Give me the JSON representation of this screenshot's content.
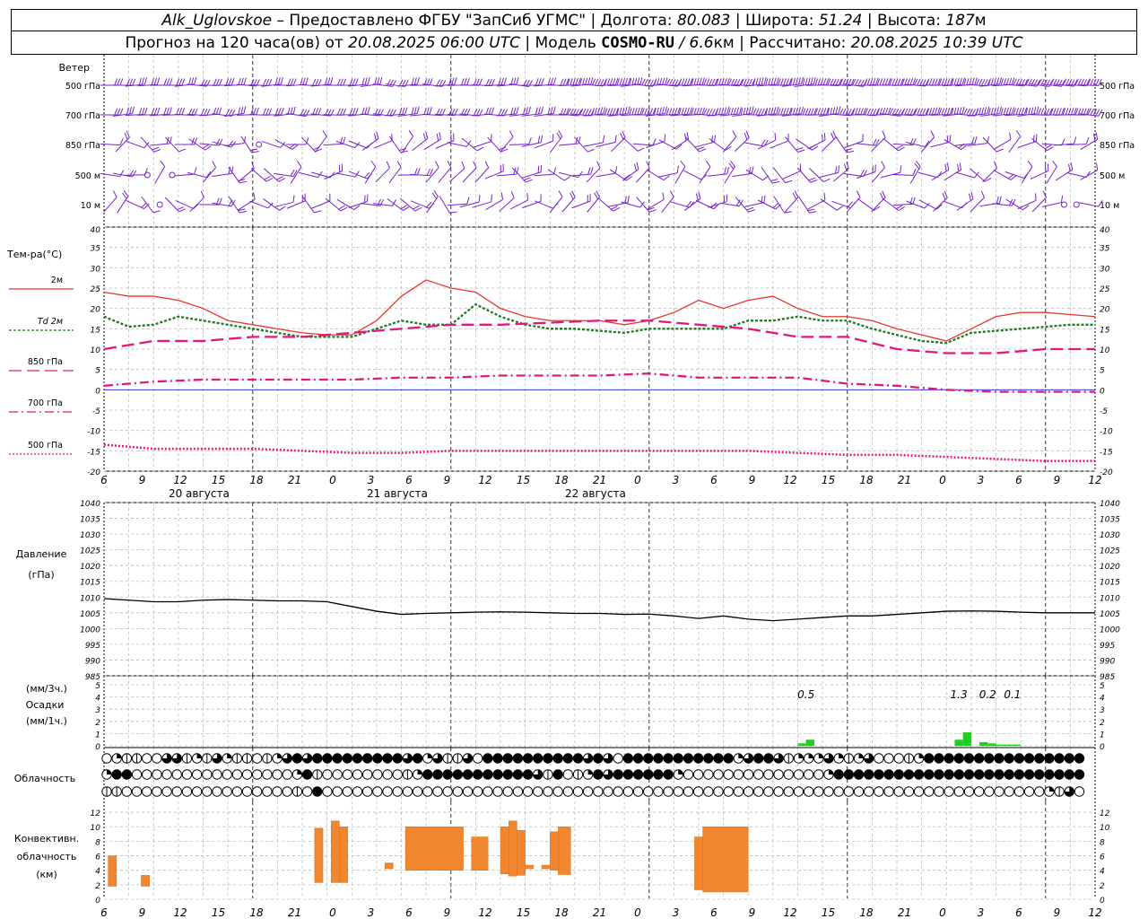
{
  "header": {
    "station": "Alk_Uglovskoe",
    "provider_text": " – Предоставлено ФГБУ \"ЗапСиб УГМС\" | Долгота: ",
    "longitude": "80.083",
    "lat_label": " | Широта: ",
    "latitude": "51.24",
    "alt_label": " | Высота: ",
    "altitude": "187",
    "alt_unit": "м",
    "forecast_label": "Прогноз на 120 часа(ов) от ",
    "forecast_from": "20.08.2025 06:00 UTC",
    "model_label": "  | Модель ",
    "model_name": "COSMO-RU",
    "resolution": " / 6.6",
    "resolution_unit": "км",
    "calc_label": " | Рассчитано: ",
    "calc_time": "20.08.2025 10:39 UTC"
  },
  "labels": {
    "wind": "Ветер",
    "wind_levels": [
      "500 гПа",
      "700 гПа",
      "850 гПа",
      "500 м",
      "10  м"
    ],
    "temp": "Тем-ра(°C)",
    "temp_legend": [
      "2м",
      "Td  2м",
      "850 гПа",
      "700 гПа",
      "500 гПа"
    ],
    "pressure": [
      "Давление",
      "(гПа)"
    ],
    "precip": [
      "(мм/3ч.)",
      "Осадки",
      "(мм/1ч.)"
    ],
    "cloud": "Облачность",
    "conv": [
      "Конвективн.",
      "облачность",
      "(км)"
    ],
    "dates": [
      "20 августа",
      "21 августа",
      "22 августа"
    ]
  },
  "colors": {
    "t2m": "#e8372c",
    "td2m": "#1e7a1e",
    "t850": "#e0197d",
    "t700": "#e0197d",
    "t500": "#e0197d",
    "pressure": "#000000",
    "precip": "#22cc22",
    "conv": "#f0862e",
    "wind": "#7722cc",
    "zero_line": "#2222cc"
  },
  "chart_data": [
    {
      "type": "line",
      "title": "Тем-ра(°C)",
      "x_unit": "hours since 20.08 06 UTC",
      "x_ticks": [
        "6",
        "9",
        "12",
        "15",
        "18",
        "21",
        "0",
        "3",
        "6",
        "9",
        "12",
        "15",
        "18",
        "21",
        "0",
        "3",
        "6",
        "9",
        "12",
        "15",
        "18",
        "21",
        "0",
        "3",
        "6",
        "9",
        "12"
      ],
      "ylim": [
        -20,
        40
      ],
      "y_ticks": [
        -20,
        -15,
        -10,
        -5,
        0,
        5,
        10,
        15,
        20,
        25,
        30,
        35,
        40
      ],
      "series": [
        {
          "name": "2м",
          "x": [
            0,
            3,
            6,
            9,
            12,
            15,
            18,
            21,
            24,
            27,
            30,
            33,
            36,
            39,
            42,
            45,
            48,
            51,
            54,
            57,
            60,
            63,
            66,
            69,
            72,
            75,
            78,
            81,
            84,
            87,
            90,
            93,
            96,
            99,
            102,
            105,
            108,
            111,
            114,
            117,
            120
          ],
          "y": [
            24,
            23,
            23,
            22,
            20,
            17,
            16,
            15,
            14,
            13.5,
            13.5,
            17,
            23,
            27,
            25,
            24,
            20,
            18,
            17,
            17,
            17,
            16,
            17,
            19,
            22,
            20,
            22,
            23,
            20,
            18,
            18,
            17,
            15,
            13.5,
            12,
            15,
            18,
            19,
            19,
            18.5,
            18
          ]
        },
        {
          "name": "Td  2м",
          "x": [
            0,
            3,
            6,
            9,
            12,
            15,
            18,
            21,
            24,
            27,
            30,
            33,
            36,
            39,
            42,
            45,
            48,
            51,
            54,
            57,
            60,
            63,
            66,
            69,
            72,
            75,
            78,
            81,
            84,
            87,
            90,
            93,
            96,
            99,
            102,
            105,
            108,
            111,
            114,
            117,
            120
          ],
          "y": [
            18,
            15.5,
            16,
            18,
            17,
            16,
            15,
            14,
            13,
            13,
            13,
            15,
            17,
            16,
            16,
            21,
            18,
            16,
            15,
            15,
            14.5,
            14,
            15,
            15,
            15,
            15,
            17,
            17,
            18,
            17,
            17,
            15,
            13.5,
            12,
            11.5,
            14,
            14.5,
            15,
            15.5,
            16,
            16
          ]
        },
        {
          "name": "850 гПа",
          "x": [
            0,
            6,
            12,
            18,
            24,
            30,
            36,
            42,
            48,
            54,
            60,
            66,
            72,
            78,
            84,
            90,
            96,
            102,
            108,
            114,
            120
          ],
          "y": [
            10,
            12,
            12,
            13,
            13,
            14,
            15,
            16,
            16,
            16.5,
            17,
            17,
            16,
            15,
            13,
            13,
            10,
            9,
            9,
            10,
            10
          ]
        },
        {
          "name": "700 гПа",
          "x": [
            0,
            6,
            12,
            18,
            24,
            30,
            36,
            42,
            48,
            54,
            60,
            66,
            72,
            78,
            84,
            90,
            96,
            102,
            108,
            114,
            120
          ],
          "y": [
            1,
            2,
            2.5,
            2.5,
            2.5,
            2.5,
            3,
            3,
            3.5,
            3.5,
            3.5,
            4,
            3,
            3,
            3,
            1.5,
            1,
            0,
            -0.5,
            -0.5,
            -0.5
          ]
        },
        {
          "name": "500 гПа",
          "x": [
            0,
            6,
            12,
            18,
            24,
            30,
            36,
            42,
            48,
            54,
            60,
            66,
            72,
            78,
            84,
            90,
            96,
            102,
            108,
            114,
            120
          ],
          "y": [
            -13.5,
            -14.5,
            -14.5,
            -14.5,
            -15,
            -15.5,
            -15.5,
            -15,
            -15,
            -15,
            -15,
            -15,
            -15,
            -15,
            -15.5,
            -16,
            -16,
            -16.5,
            -17,
            -17.5,
            -17.5
          ]
        }
      ]
    },
    {
      "type": "line",
      "title": "Давление (гПа)",
      "ylim": [
        985,
        1040
      ],
      "y_ticks": [
        985,
        990,
        995,
        1000,
        1005,
        1010,
        1015,
        1020,
        1025,
        1030,
        1035,
        1040
      ],
      "series": [
        {
          "name": "Давление",
          "x": [
            0,
            3,
            6,
            9,
            12,
            15,
            18,
            21,
            24,
            27,
            30,
            33,
            36,
            39,
            42,
            45,
            48,
            51,
            54,
            57,
            60,
            63,
            66,
            69,
            72,
            75,
            78,
            81,
            84,
            87,
            90,
            93,
            96,
            99,
            102,
            105,
            108,
            111,
            114,
            117,
            120
          ],
          "y": [
            1009.5,
            1009,
            1008.5,
            1008.5,
            1009,
            1009.2,
            1009,
            1008.8,
            1008.8,
            1008.5,
            1007,
            1005.5,
            1004.5,
            1004.8,
            1005,
            1005.2,
            1005.3,
            1005.2,
            1005,
            1004.8,
            1004.8,
            1004.5,
            1004.6,
            1004,
            1003.2,
            1004,
            1003,
            1002.5,
            1003,
            1003.5,
            1004,
            1004,
            1004.5,
            1005,
            1005.5,
            1005.6,
            1005.5,
            1005.2,
            1005,
            1005,
            1005
          ]
        }
      ]
    },
    {
      "type": "bar",
      "title": "Осадки",
      "ylim": [
        0,
        5
      ],
      "y_ticks": [
        0,
        1,
        2,
        3,
        4,
        5
      ],
      "bars": [
        {
          "x": 84.5,
          "value": 0.2
        },
        {
          "x": 85.5,
          "value": 0.5
        },
        {
          "x": 103.5,
          "value": 0.5
        },
        {
          "x": 104.5,
          "value": 1.1
        },
        {
          "x": 106.5,
          "value": 0.3
        },
        {
          "x": 107.5,
          "value": 0.2
        },
        {
          "x": 108.5,
          "value": 0.1
        },
        {
          "x": 109.5,
          "value": 0.1
        },
        {
          "x": 110.5,
          "value": 0.1
        }
      ],
      "annotations": [
        {
          "x": 85,
          "text": "0.5"
        },
        {
          "x": 103.5,
          "text": "1.3"
        },
        {
          "x": 107,
          "text": "0.2"
        },
        {
          "x": 110,
          "text": "0.1"
        }
      ]
    },
    {
      "type": "bar",
      "title": "Конвективн. облачность (км)",
      "ylim": [
        0,
        13
      ],
      "y_ticks": [
        0,
        2,
        4,
        6,
        8,
        10,
        12
      ],
      "bars": [
        {
          "x0": 0.5,
          "x1": 1.5,
          "base": 1.8,
          "top": 6
        },
        {
          "x0": 4.5,
          "x1": 5.5,
          "base": 1.8,
          "top": 3.3
        },
        {
          "x0": 25.5,
          "x1": 26.5,
          "base": 2.3,
          "top": 9.8
        },
        {
          "x0": 27.5,
          "x1": 28.5,
          "base": 2.3,
          "top": 10.8
        },
        {
          "x0": 28.5,
          "x1": 29.5,
          "base": 2.3,
          "top": 10
        },
        {
          "x0": 34,
          "x1": 35,
          "base": 4.2,
          "top": 5
        },
        {
          "x0": 36.5,
          "x1": 43.5,
          "base": 4,
          "top": 10
        },
        {
          "x0": 44.5,
          "x1": 46.5,
          "base": 4,
          "top": 8.6
        },
        {
          "x0": 48,
          "x1": 49,
          "base": 3.5,
          "top": 10
        },
        {
          "x0": 49,
          "x1": 50,
          "base": 3.2,
          "top": 10.8
        },
        {
          "x0": 50,
          "x1": 51,
          "base": 3.3,
          "top": 9.5
        },
        {
          "x0": 51,
          "x1": 52,
          "base": 4.2,
          "top": 4.7
        },
        {
          "x0": 53,
          "x1": 54,
          "base": 4.2,
          "top": 4.7
        },
        {
          "x0": 54,
          "x1": 55,
          "base": 4,
          "top": 9.3
        },
        {
          "x0": 55,
          "x1": 56.5,
          "base": 3.4,
          "top": 10
        },
        {
          "x0": 71.5,
          "x1": 72.5,
          "base": 1.3,
          "top": 8.6
        },
        {
          "x0": 72.5,
          "x1": 78,
          "base": 1,
          "top": 10
        }
      ]
    },
    {
      "type": "table",
      "title": "Облачность",
      "rows": [
        [
          0,
          2,
          1,
          1,
          0,
          0,
          3,
          3,
          1,
          2,
          1,
          3,
          2,
          1,
          1,
          0,
          1,
          2,
          3,
          4,
          3,
          4,
          4,
          4,
          4,
          4,
          4,
          4,
          4,
          4,
          3,
          4,
          2,
          3,
          1,
          1,
          3,
          0,
          4,
          4,
          4,
          4,
          4,
          4,
          4,
          4,
          4,
          4,
          3,
          4,
          3,
          0,
          4,
          4,
          4,
          4,
          4,
          4,
          4,
          4,
          4,
          4,
          4,
          2,
          3,
          4,
          4,
          3,
          1,
          2,
          2,
          2,
          3,
          2,
          1,
          2,
          3,
          0,
          0,
          0,
          1,
          2,
          4,
          4,
          4,
          4,
          4,
          4,
          4,
          4,
          4,
          4,
          4,
          4,
          4,
          4,
          4,
          4
        ],
        [
          2,
          4,
          4,
          0,
          0,
          0,
          0,
          0,
          0,
          0,
          0,
          0,
          0,
          0,
          0,
          0,
          0,
          0,
          0,
          2,
          4,
          1,
          0,
          0,
          0,
          0,
          0,
          0,
          0,
          0,
          1,
          2,
          4,
          4,
          4,
          4,
          4,
          4,
          4,
          4,
          4,
          4,
          4,
          3,
          1,
          4,
          0,
          1,
          2,
          4,
          3,
          4,
          4,
          4,
          4,
          4,
          4,
          2,
          0,
          0,
          0,
          0,
          0,
          0,
          0,
          0,
          0,
          0,
          0,
          0,
          0,
          0,
          2,
          4,
          4,
          4,
          4,
          4,
          4,
          4,
          4,
          4,
          4,
          4,
          4,
          4,
          4,
          4,
          4,
          4,
          4,
          4,
          4,
          4,
          4,
          4,
          4,
          4
        ],
        [
          1,
          1,
          0,
          0,
          0,
          0,
          0,
          0,
          0,
          0,
          0,
          0,
          0,
          0,
          0,
          0,
          0,
          0,
          0,
          1,
          0,
          4,
          0,
          0,
          0,
          0,
          0,
          0,
          0,
          0,
          0,
          0,
          0,
          0,
          0,
          0,
          0,
          0,
          0,
          0,
          0,
          0,
          0,
          0,
          0,
          0,
          0,
          0,
          0,
          0,
          0,
          0,
          0,
          0,
          0,
          0,
          0,
          0,
          0,
          0,
          0,
          0,
          0,
          0,
          0,
          0,
          0,
          0,
          0,
          0,
          0,
          0,
          0,
          0,
          0,
          0,
          0,
          0,
          0,
          0,
          0,
          0,
          0,
          0,
          0,
          0,
          0,
          0,
          0,
          0,
          0,
          0,
          0,
          0,
          2,
          1,
          3,
          0
        ]
      ]
    }
  ]
}
